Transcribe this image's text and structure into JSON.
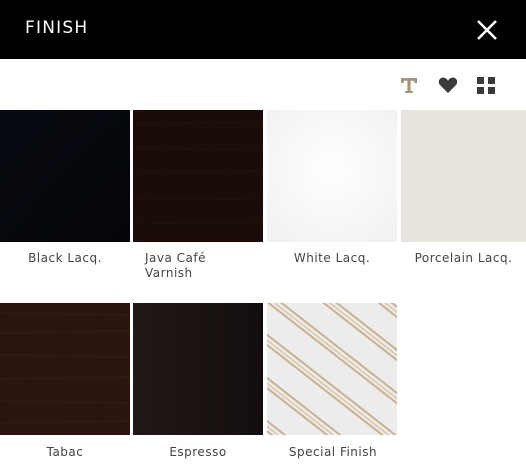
{
  "header": {
    "title": "FINISH"
  },
  "colors": {
    "header_bg": "#000000",
    "accent_tan": "#a7927a",
    "icon_dark": "#3a3a3a"
  },
  "toolbar": {
    "icons": [
      "text-icon",
      "heart-icon",
      "grid-icon"
    ]
  },
  "finishes": [
    {
      "label": "Black Lacq.",
      "color": "#05070c"
    },
    {
      "label": "Java Café\nVarnish",
      "color": "#1a0d09"
    },
    {
      "label": "White Lacq.",
      "color": "#fbfaf9"
    },
    {
      "label": "Porcelain Lacq.",
      "color": "#e8e4dd"
    },
    {
      "label": "Tabac",
      "color": "#2a140e"
    },
    {
      "label": "Espresso",
      "color": "#1a1312"
    },
    {
      "label": "Special Finish",
      "color": "#e8e8e8"
    }
  ]
}
